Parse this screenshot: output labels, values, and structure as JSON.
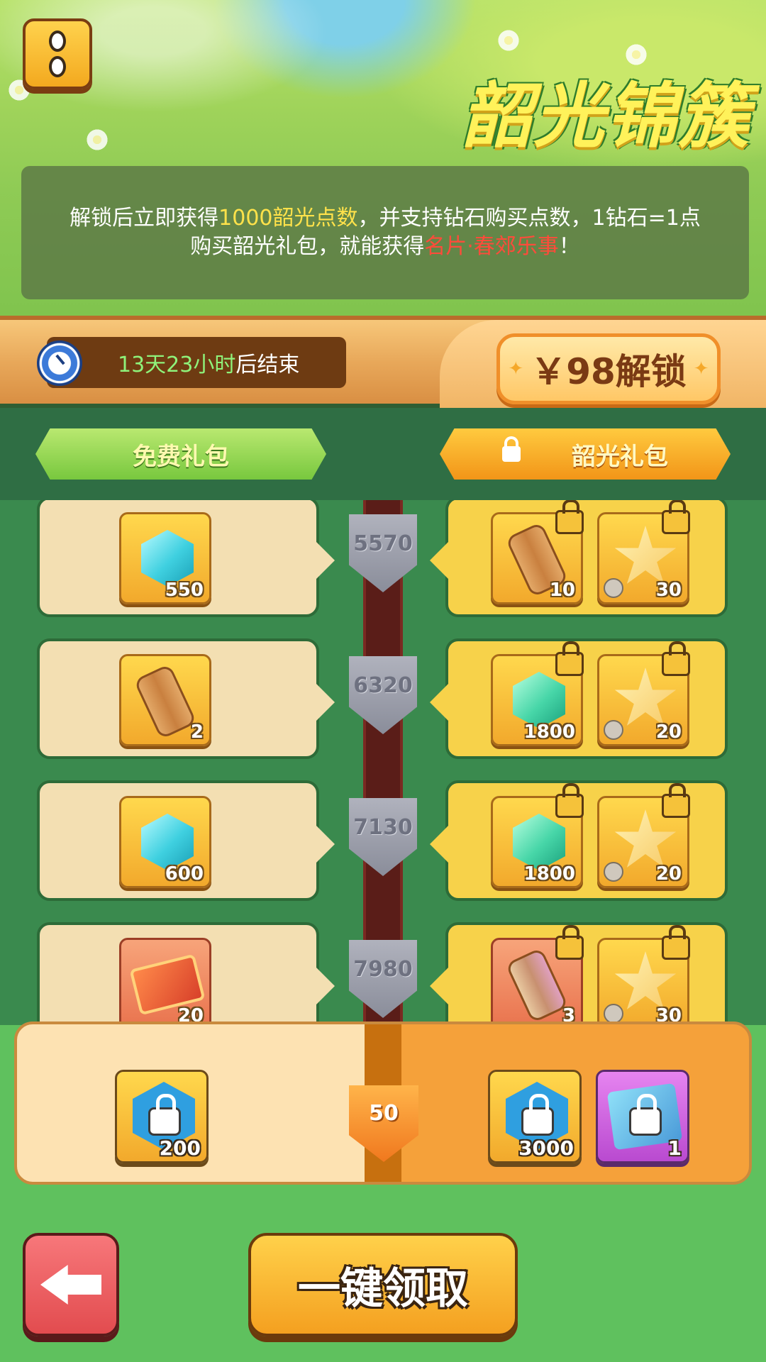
{
  "header": {
    "title": "韶光锦簇",
    "menu_icon": "menu-icon"
  },
  "info": {
    "line1_prefix": "解锁后立即获得",
    "line1_highlight": "1000韶光点数",
    "line1_suffix": "，并支持钻石购买点数，1钻石=1点",
    "line2_prefix": "购买韶光礼包，就能获得",
    "line2_highlight": "名片·春郊乐事",
    "line2_suffix": "！",
    "colors": {
      "highlight_yellow": "#ffe24a",
      "highlight_red": "#ff4b3a"
    }
  },
  "timer": {
    "remaining": "13天23小时",
    "suffix": "后结束"
  },
  "unlock": {
    "label": "￥98解锁"
  },
  "tabs": {
    "free": "免费礼包",
    "paid": "韶光礼包"
  },
  "rows": [
    {
      "points": "5570",
      "free": {
        "icon": "blue-gem-icon",
        "qty": "550"
      },
      "paid": [
        {
          "icon": "scroll-icon",
          "qty": "10",
          "locked": true
        },
        {
          "icon": "star-icon",
          "qty": "30",
          "locked": true,
          "timed": true
        }
      ]
    },
    {
      "points": "6320",
      "free": {
        "icon": "scroll-icon",
        "qty": "2"
      },
      "paid": [
        {
          "icon": "green-gem-icon",
          "qty": "1800",
          "locked": true
        },
        {
          "icon": "star-icon",
          "qty": "20",
          "locked": true,
          "timed": true
        }
      ]
    },
    {
      "points": "7130",
      "free": {
        "icon": "blue-gem-icon",
        "qty": "600"
      },
      "paid": [
        {
          "icon": "green-gem-icon",
          "qty": "1800",
          "locked": true
        },
        {
          "icon": "star-icon",
          "qty": "20",
          "locked": true,
          "timed": true
        }
      ]
    },
    {
      "points": "7980",
      "free": {
        "icon": "red-card-icon",
        "qty": "20"
      },
      "paid": [
        {
          "icon": "purple-scroll-icon",
          "qty": "3",
          "locked": true
        },
        {
          "icon": "star-icon",
          "qty": "30",
          "locked": true,
          "timed": true
        }
      ]
    }
  ],
  "summary": {
    "level": "50",
    "free_item": {
      "icon": "locked-avatar-frame-icon",
      "qty": "200"
    },
    "paid_items": [
      {
        "icon": "locked-avatar-frame-icon",
        "qty": "3000"
      },
      {
        "icon": "locked-name-card-icon",
        "qty": "1"
      }
    ]
  },
  "footer": {
    "back_icon": "back-arrow-icon",
    "claim_all": "一键领取"
  }
}
